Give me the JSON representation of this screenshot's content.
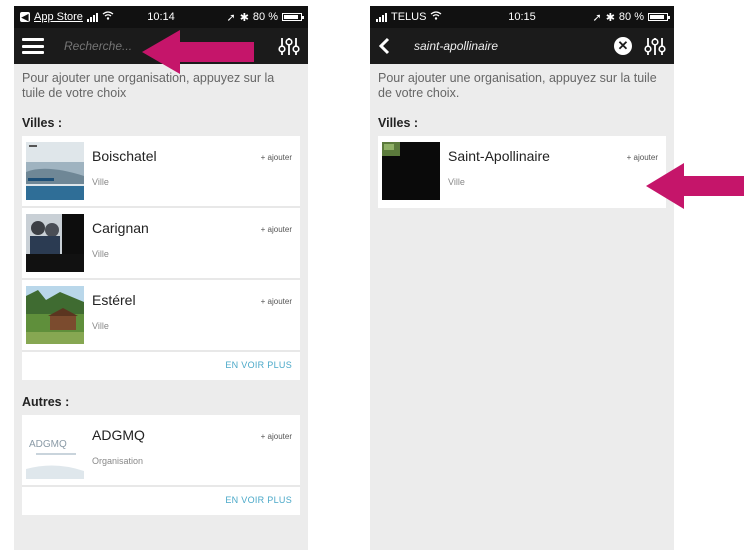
{
  "colors": {
    "accent_arrow": "#c5156a",
    "link": "#4aa8c8",
    "navbar": "#1b1b1b",
    "background": "#ececec"
  },
  "left_screen": {
    "status_bar": {
      "back_label": "App Store",
      "time": "10:14",
      "battery_text": "80 %"
    },
    "nav": {
      "search_placeholder": "Recherche..."
    },
    "intro": "Pour ajouter une organisation, appuyez sur la tuile de votre choix",
    "sections": [
      {
        "title": "Villes :",
        "items": [
          {
            "title": "Boischatel",
            "subtitle": "Ville",
            "add": "+ ajouter"
          },
          {
            "title": "Carignan",
            "subtitle": "Ville",
            "add": "+ ajouter"
          },
          {
            "title": "Estérel",
            "subtitle": "Ville",
            "add": "+ ajouter"
          }
        ],
        "see_more": "EN VOIR PLUS"
      },
      {
        "title": "Autres :",
        "items": [
          {
            "title": "ADGMQ",
            "subtitle": "Organisation",
            "add": "+ ajouter",
            "logo_text": "ADGMQ"
          }
        ],
        "see_more": "EN VOIR PLUS"
      }
    ]
  },
  "right_screen": {
    "status_bar": {
      "carrier": "TELUS",
      "time": "10:15",
      "battery_text": "80 %"
    },
    "nav": {
      "search_text": "saint-apollinaire"
    },
    "intro": "Pour ajouter une organisation, appuyez sur la tuile de votre choix.",
    "sections": [
      {
        "title": "Villes :",
        "items": [
          {
            "title": "Saint-Apollinaire",
            "subtitle": "Ville",
            "add": "+ ajouter"
          }
        ]
      }
    ]
  }
}
